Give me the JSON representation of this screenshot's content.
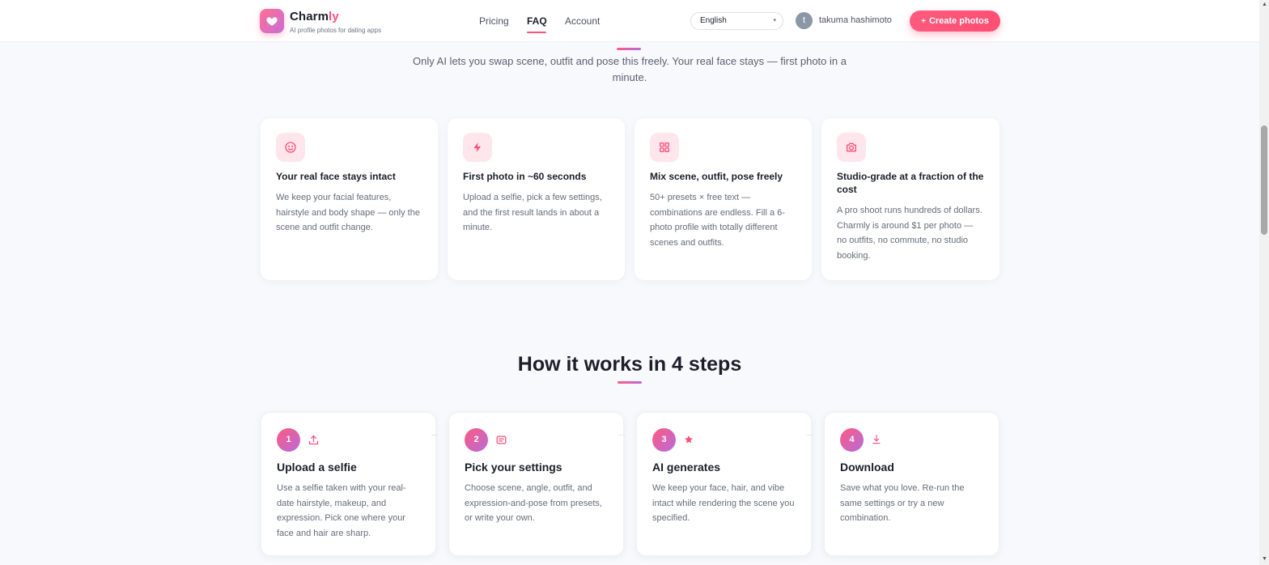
{
  "header": {
    "brand_prefix": "Charm",
    "brand_suffix": "ly",
    "tagline": "AI profile photos for dating apps",
    "nav": [
      {
        "label": "Pricing"
      },
      {
        "label": "FAQ",
        "active": true
      },
      {
        "label": "Account"
      }
    ],
    "language": "English",
    "avatar_initial": "t",
    "username": "takuma hashimoto",
    "cta_label": "Create photos"
  },
  "intro": {
    "text": "Only AI lets you swap scene, outfit and pose this freely. Your real face stays — first photo in a minute."
  },
  "features": [
    {
      "icon": "smile-icon",
      "title": "Your real face stays intact",
      "desc": "We keep your facial features, hairstyle and body shape — only the scene and outfit change."
    },
    {
      "icon": "lightning-icon",
      "title": "First photo in ~60 seconds",
      "desc": "Upload a selfie, pick a few settings, and the first result lands in about a minute."
    },
    {
      "icon": "grid-icon",
      "title": "Mix scene, outfit, pose freely",
      "desc": "50+ presets × free text — combinations are endless. Fill a 6-photo profile with totally different scenes and outfits."
    },
    {
      "icon": "camera-icon",
      "title": "Studio-grade at a fraction of the cost",
      "desc": "A pro shoot runs hundreds of dollars. Charmly is around $1 per photo — no outfits, no commute, no studio booking."
    }
  ],
  "steps_section": {
    "title": "How it works in 4 steps",
    "steps": [
      {
        "number": "1",
        "icon": "upload-icon",
        "title": "Upload a selfie",
        "desc": "Use a selfie taken with your real-date hairstyle, makeup, and expression. Pick one where your face and hair are sharp."
      },
      {
        "number": "2",
        "icon": "settings-card-icon",
        "title": "Pick your settings",
        "desc": "Choose scene, angle, outfit, and expression-and-pose from presets, or write your own."
      },
      {
        "number": "3",
        "icon": "star-icon",
        "title": "AI generates",
        "desc": "We keep your face, hair, and vibe intact while rendering the scene you specified."
      },
      {
        "number": "4",
        "icon": "download-icon",
        "title": "Download",
        "desc": "Save what you love. Re-run the same settings or try a new combination."
      }
    ]
  },
  "colors": {
    "accent": "#ff4f7b",
    "accent_gradient_end": "#b66bdc",
    "icon_bg": "#ffe6ec",
    "page_bg": "#f8f9fc"
  }
}
